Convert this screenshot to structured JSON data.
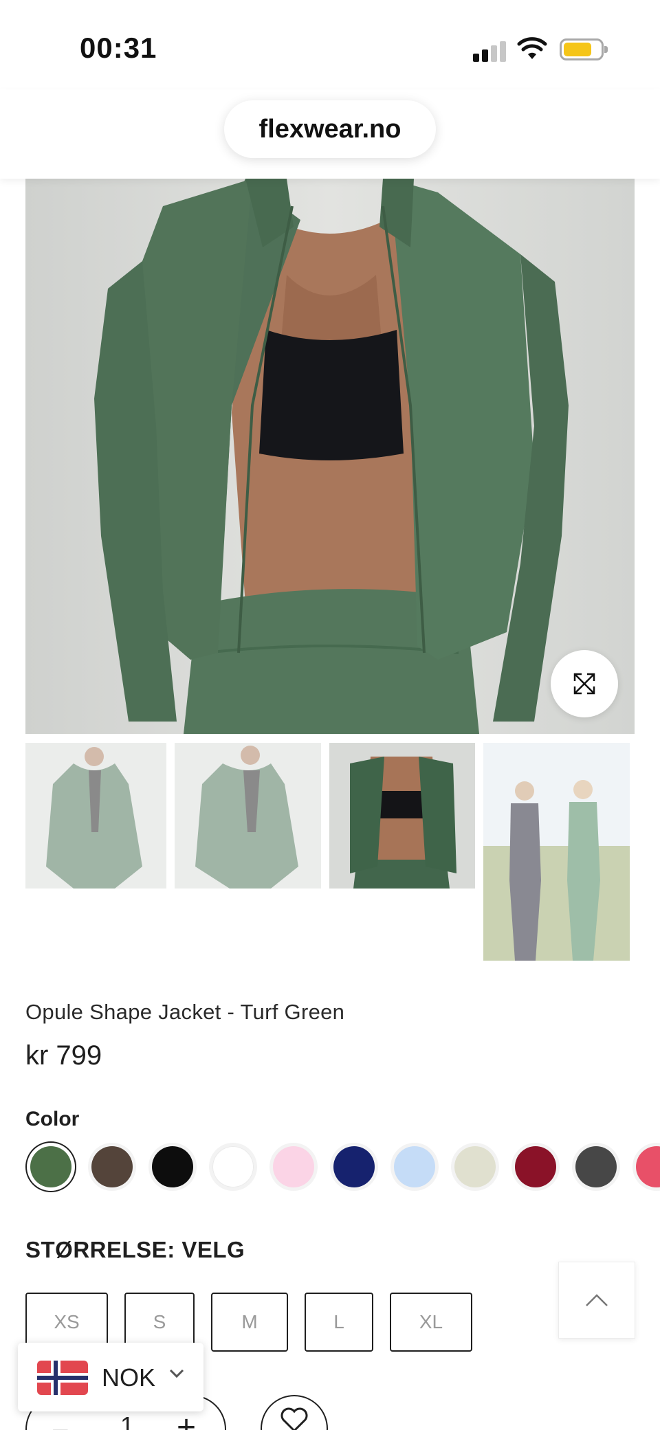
{
  "status_bar": {
    "time": "00:31"
  },
  "browser": {
    "url": "flexwear.no"
  },
  "product": {
    "title": "Opule Shape Jacket - Turf Green",
    "price": "kr 799"
  },
  "color": {
    "label": "Color",
    "swatches": [
      "#4c7047",
      "#54443a",
      "#0d0d0d",
      "#ffffff",
      "#fbd4e6",
      "#16226e",
      "#c5dcf7",
      "#e0e0cf",
      "#8a1228",
      "#474747",
      "#e85068"
    ],
    "selected_index": 0
  },
  "size": {
    "label": "STØRRELSE: VELG",
    "options": [
      "XS",
      "S",
      "M",
      "L",
      "XL"
    ]
  },
  "quantity": {
    "minus": "−",
    "value": "1",
    "plus": "+"
  },
  "currency": {
    "code": "NOK"
  },
  "icons": {
    "zoom": "expand-arrows-icon",
    "back_to_top": "chevron-up-icon",
    "wishlist": "heart-icon",
    "currency_dropdown": "chevron-down-icon",
    "flag": "norway-flag-icon"
  }
}
